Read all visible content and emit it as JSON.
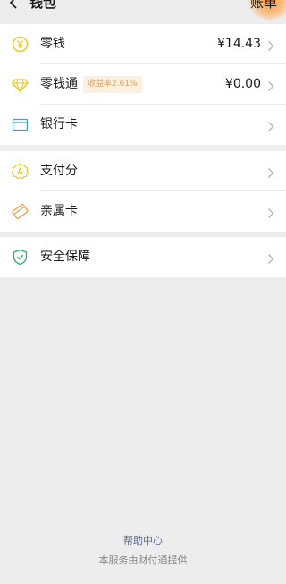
{
  "header": {
    "title": "钱包",
    "bill_label": "账单",
    "back_icon": "chevron-left-icon"
  },
  "groups": [
    {
      "rows": [
        {
          "label": "零钱",
          "value": "¥14.43",
          "icon": "coin-yen-icon"
        },
        {
          "label": "零钱通",
          "badge": "收益率2.61%",
          "value": "¥0.00",
          "icon": "diamond-icon"
        },
        {
          "label": "银行卡",
          "icon": "bank-card-icon"
        }
      ]
    },
    {
      "rows": [
        {
          "label": "支付分",
          "icon": "pay-score-icon"
        },
        {
          "label": "亲属卡",
          "icon": "family-card-icon"
        }
      ]
    },
    {
      "rows": [
        {
          "label": "安全保障",
          "icon": "shield-check-icon"
        }
      ]
    }
  ],
  "footer": {
    "help_link": "帮助中心",
    "provider_text": "本服务由财付通提供"
  },
  "colors": {
    "icon_yellow": "#f0c419",
    "icon_blue": "#3aa3d6",
    "icon_orange": "#f0a050",
    "icon_green": "#21b36a",
    "badge_text": "#e0a25a",
    "badge_bg": "#fdf0e0",
    "link": "#576b95",
    "bill_glow": "#ff9640"
  }
}
